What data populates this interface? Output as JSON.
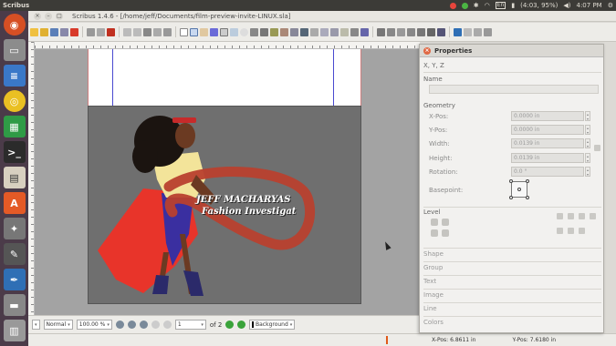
{
  "topbar": {
    "app_name": "Scribus",
    "battery": "(4:03, 95%)",
    "time": "4:07 PM",
    "keyboard": "En"
  },
  "window": {
    "title": "Scribus 1.4.6 - [/home/jeff/Documents/film-preview-invite-LINUX.sla]"
  },
  "canvas": {
    "caption_line1": "JEFF MACHARYAS",
    "caption_line2": "Fashion Investigat"
  },
  "statusbar": {
    "mode_value": "Normal",
    "zoom_value": "100.00 %",
    "page_value": "1",
    "page_of": "of 2",
    "layer_value": "Background"
  },
  "bottombar": {
    "xpos": "X-Pos:  6.8611 in",
    "ypos": "Y-Pos:  7.6180 in"
  },
  "properties": {
    "title": "Properties",
    "xyz_label": "X, Y, Z",
    "name_label": "Name",
    "name_value": "",
    "geometry_label": "Geometry",
    "xpos_label": "X-Pos:",
    "xpos_value": "0.0000 in",
    "ypos_label": "Y-Pos:",
    "ypos_value": "0.0000 in",
    "width_label": "Width:",
    "width_value": "0.0139 in",
    "height_label": "Height:",
    "height_value": "0.0139 in",
    "rotation_label": "Rotation:",
    "rotation_value": "0.0 °",
    "basepoint_label": "Basepoint:",
    "level_label": "Level",
    "sections": [
      "Shape",
      "Group",
      "Text",
      "Image",
      "Line",
      "Colors"
    ]
  },
  "colors": {
    "page_main": "#6f6f6f",
    "dress_red": "#e8342a",
    "brush_stroke": "#b8402e"
  }
}
